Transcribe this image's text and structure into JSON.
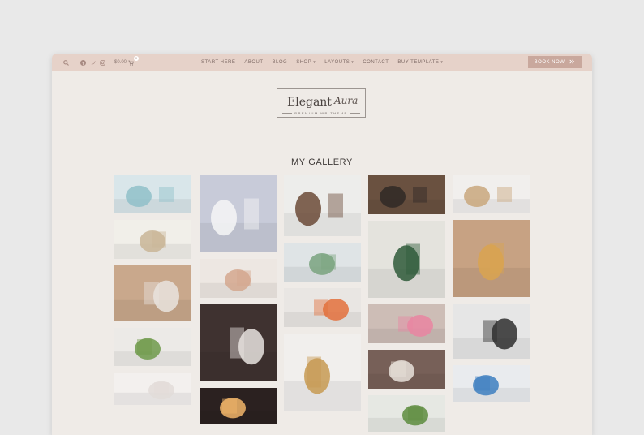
{
  "header": {
    "cart_total": "$0.00",
    "cart_count": "0",
    "nav": [
      {
        "label": "START HERE",
        "dropdown": false
      },
      {
        "label": "ABOUT",
        "dropdown": false
      },
      {
        "label": "BLOG",
        "dropdown": false
      },
      {
        "label": "SHOP",
        "dropdown": true
      },
      {
        "label": "LAYOUTS",
        "dropdown": true
      },
      {
        "label": "CONTACT",
        "dropdown": false
      },
      {
        "label": "BUY TEMPLATE",
        "dropdown": true
      }
    ],
    "cta_label": "BOOK NOW",
    "cta_icon": "double-chevron-right-icon"
  },
  "logo": {
    "word": "Elegant",
    "script": "Aura",
    "tagline": "PREMIUM WP THEME"
  },
  "gallery": {
    "title": "MY GALLERY",
    "columns": [
      [
        {
          "subject": "kitchen-utensils",
          "bg": "#d9e6ea",
          "fg": "#8fc0c9"
        },
        {
          "subject": "coffee-flatlay",
          "bg": "#f1efe9",
          "fg": "#c9b596"
        },
        {
          "subject": "woman-laptop",
          "bg": "#c9a88c",
          "fg": "#e9e3de"
        },
        {
          "subject": "salad-bowls",
          "bg": "#eceae7",
          "fg": "#6e9a4a"
        },
        {
          "subject": "curtain-room",
          "bg": "#f3f0ee",
          "fg": "#e2dcd8"
        }
      ],
      [
        {
          "subject": "diffuser-candles",
          "bg": "#c8cbd9",
          "fg": "#f6f6f6"
        },
        {
          "subject": "flowers-table",
          "bg": "#ede7e2",
          "fg": "#d4a78e"
        },
        {
          "subject": "moon-lamp",
          "bg": "#3f3230",
          "fg": "#e8e3df"
        },
        {
          "subject": "lamp-glow",
          "bg": "#2b2120",
          "fg": "#f1b56a"
        }
      ],
      [
        {
          "subject": "books-bookends",
          "bg": "#ededeb",
          "fg": "#6b4a37"
        },
        {
          "subject": "desk-notebook",
          "bg": "#dfe4e6",
          "fg": "#7aa37f"
        },
        {
          "subject": "team-desk",
          "bg": "#e9e6e3",
          "fg": "#e3703c"
        },
        {
          "subject": "gold-deer",
          "bg": "#f1efed",
          "fg": "#c79a52"
        }
      ],
      [
        {
          "subject": "wooden-floor",
          "bg": "#6a5140",
          "fg": "#2f2926"
        },
        {
          "subject": "green-rug",
          "bg": "#e4e3dd",
          "fg": "#2f5b3a"
        },
        {
          "subject": "pink-crafts",
          "bg": "#cdbdb6",
          "fg": "#e985a1"
        },
        {
          "subject": "baking-table",
          "bg": "#776058",
          "fg": "#e8e2da"
        },
        {
          "subject": "hands-vegetables",
          "bg": "#e6e8e3",
          "fg": "#5d8c3e"
        }
      ],
      [
        {
          "subject": "wall-shelf",
          "bg": "#f1efed",
          "fg": "#c9a77c"
        },
        {
          "subject": "deer-checker",
          "bg": "#c7a283",
          "fg": "#d9a350"
        },
        {
          "subject": "white-desk",
          "bg": "#e6e6e6",
          "fg": "#2e2e2e"
        },
        {
          "subject": "blue-ball-shelf",
          "bg": "#e9ebee",
          "fg": "#3d7fc0"
        }
      ]
    ]
  }
}
